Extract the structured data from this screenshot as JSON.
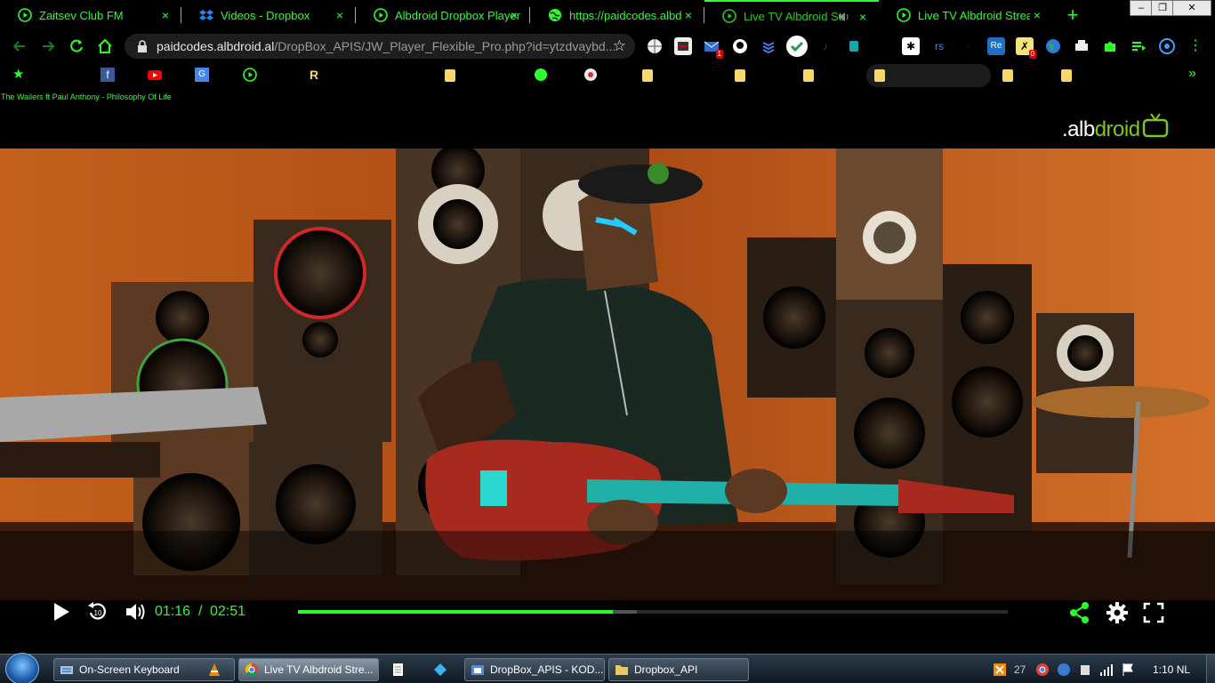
{
  "tabs": [
    {
      "label": "Zaitsev Club FM",
      "icon": "play-circle-icon"
    },
    {
      "label": "Videos - Dropbox",
      "icon": "dropbox-icon"
    },
    {
      "label": "Albdroid Dropbox Player",
      "icon": "play-circle-icon"
    },
    {
      "label": "https://paidcodes.albdroid",
      "icon": "globe-icon"
    },
    {
      "label": "Live TV Albdroid Stre",
      "icon": "play-circle-icon",
      "active": true,
      "audio": true
    },
    {
      "label": "Live TV Albdroid Stream",
      "icon": "play-circle-icon"
    }
  ],
  "tab_close": "×",
  "new_tab": "+",
  "window_controls": {
    "minimize": "–",
    "restore": "❐",
    "close": "✕"
  },
  "address": {
    "host": "paidcodes.albdroid.al",
    "path": "/DropBox_APIS/JW_Player_Flexible_Pro.php?id=ytzdvaybd..."
  },
  "extensions": [
    {
      "name": "globe-ext-icon"
    },
    {
      "name": "ext-2-icon"
    },
    {
      "name": "mail-ext-icon",
      "badge": "1"
    },
    {
      "name": "github-icon"
    },
    {
      "name": "stack-ext-icon"
    },
    {
      "name": "check-ext-icon"
    },
    {
      "name": "ext-7-icon"
    },
    {
      "name": "ext-8-icon"
    },
    {
      "name": "asterisk-ext-icon"
    },
    {
      "label": "rs"
    },
    {
      "name": "ext-11-icon"
    },
    {
      "label": "Re"
    },
    {
      "name": "ext-13-icon",
      "badge": "0"
    },
    {
      "name": "earth-ext-icon"
    },
    {
      "name": "printer-ext-icon"
    },
    {
      "name": "puzzle-icon"
    },
    {
      "name": "playlist-icon"
    },
    {
      "name": "profile-icon"
    },
    {
      "name": "more-icon"
    }
  ],
  "bookmarks_overflow": "»",
  "page": {
    "now_playing": "The Wailers ft Paul Anthony - Philosophy Of Life",
    "brand_prefix": ".alb",
    "brand_suffix": "droid"
  },
  "player": {
    "current_time": "01:16",
    "separator": "/",
    "duration": "02:51",
    "progress": 0.444,
    "buffered": 0.478,
    "colors": {
      "accent": "#2aff2a"
    }
  },
  "taskbar": {
    "buttons": [
      {
        "label": "On-Screen Keyboard",
        "icon": "keyboard-icon"
      },
      {
        "label": "",
        "icon": "vlc-icon"
      },
      {
        "label": "Live TV Albdroid Stre...",
        "icon": "chrome-icon",
        "active": true
      },
      {
        "label": "",
        "icon": "notepad-icon"
      },
      {
        "label": "",
        "icon": "kodi-icon"
      },
      {
        "label": "DropBox_APIS - KOD...",
        "icon": "folder-app-icon"
      },
      {
        "label": "Dropbox_API",
        "icon": "folder-icon"
      }
    ],
    "tray_text": "27",
    "clock": "1:10 NL"
  }
}
